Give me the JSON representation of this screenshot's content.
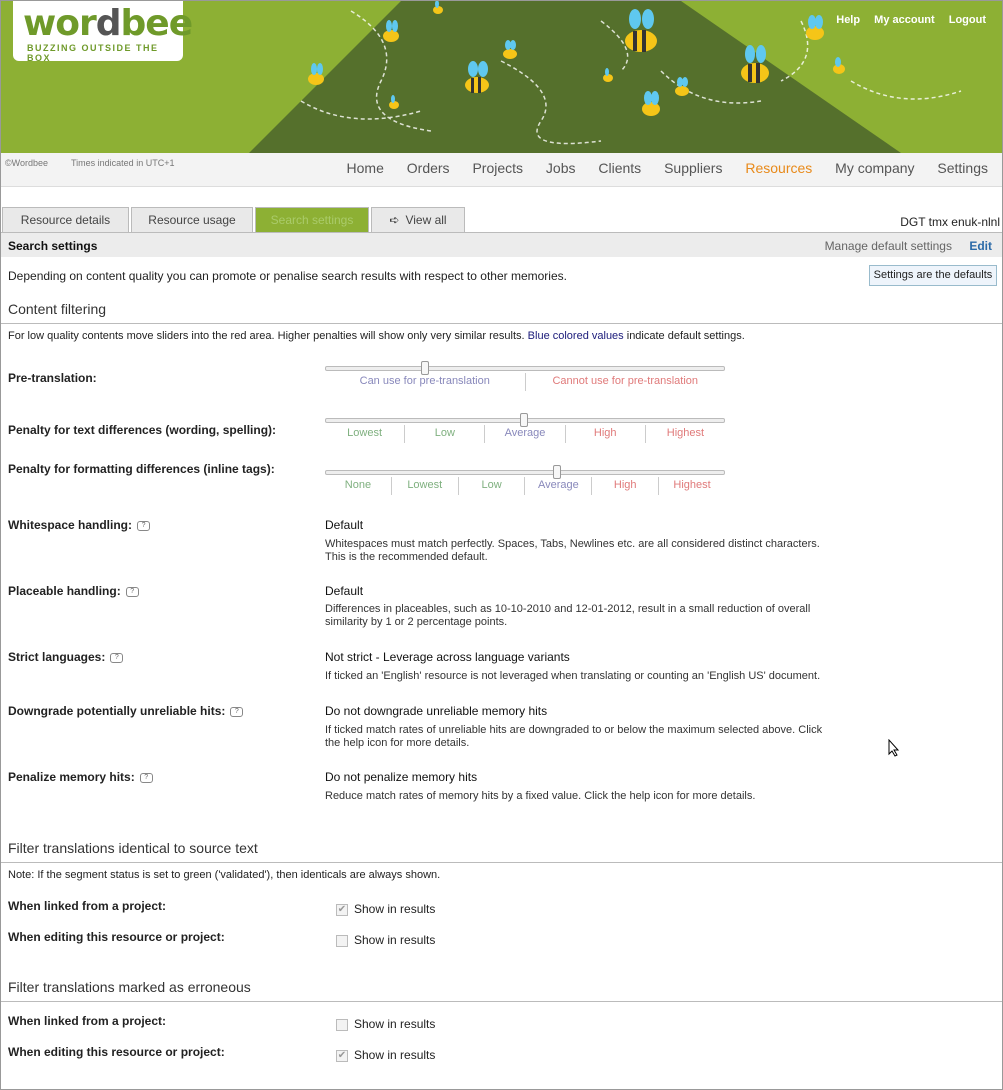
{
  "header": {
    "logo_main": "wordbee",
    "logo_tagline": "BUZZING OUTSIDE THE BOX",
    "links": [
      "Help",
      "My account",
      "Logout"
    ]
  },
  "subheader": {
    "copyright": "©Wordbee",
    "timezone": "Times indicated in UTC+1"
  },
  "nav": {
    "items": [
      "Home",
      "Orders",
      "Projects",
      "Jobs",
      "Clients",
      "Suppliers",
      "Resources",
      "My company",
      "Settings"
    ],
    "active": "Resources"
  },
  "tabs": [
    "Resource details",
    "Resource usage",
    "Search settings",
    "View all"
  ],
  "resource_name": "DGT tmx enuk-nlnl",
  "section": {
    "title": "Search settings",
    "manage_link": "Manage default settings",
    "edit_link": "Edit"
  },
  "intro": "Depending on content quality you can promote or penalise search results with respect to other memories.",
  "defaults_button": "Settings are the defaults",
  "content_filtering": {
    "heading": "Content filtering",
    "note_prefix": "For low quality contents move sliders into the red area. Higher penalties will show only very similar results.",
    "note_blue": "Blue colored values",
    "note_suffix": "indicate default settings.",
    "pretranslation": {
      "label": "Pre-translation:",
      "options": [
        "Can use for pre-translation",
        "Cannot use for pre-translation"
      ],
      "selected_index": 0
    },
    "text_diff": {
      "label": "Penalty for text differences (wording, spelling):",
      "options": [
        "Lowest",
        "Low",
        "Average",
        "High",
        "Highest"
      ],
      "selected_index": 2
    },
    "format_diff": {
      "label": "Penalty for formatting differences (inline tags):",
      "options": [
        "None",
        "Lowest",
        "Low",
        "Average",
        "High",
        "Highest"
      ],
      "selected_index": 3
    },
    "whitespace": {
      "label": "Whitespace handling:",
      "value": "Default",
      "desc": "Whitespaces must match perfectly. Spaces, Tabs, Newlines etc. are all considered distinct characters. This is the recommended default."
    },
    "placeable": {
      "label": "Placeable handling:",
      "value": "Default",
      "desc": "Differences in placeables, such as 10-10-2010 and 12-01-2012, result in a small reduction of overall similarity by 1 or 2 percentage points."
    },
    "strict_languages": {
      "label": "Strict languages:",
      "value": "Not strict - Leverage across language variants",
      "desc": "If ticked an 'English' resource is not leveraged when translating or counting an 'English US' document."
    },
    "downgrade": {
      "label": "Downgrade potentially unreliable hits:",
      "value": "Do not downgrade unreliable memory hits",
      "desc": "If ticked match rates of unreliable hits are downgraded to or below the maximum selected above. Click the help icon for more details."
    },
    "penalize": {
      "label": "Penalize memory hits:",
      "value": "Do not penalize memory hits",
      "desc": "Reduce match rates of memory hits by a fixed value. Click the help icon for more details."
    }
  },
  "identical": {
    "heading": "Filter translations identical to source text",
    "note": "Note: If the segment status is set to green ('validated'), then identicals are always shown.",
    "rows": [
      {
        "label": "When linked from a project:",
        "option": "Show in results",
        "checked": true
      },
      {
        "label": "When editing this resource or project:",
        "option": "Show in results",
        "checked": false
      }
    ]
  },
  "erroneous": {
    "heading": "Filter translations marked as erroneous",
    "rows": [
      {
        "label": "When linked from a project:",
        "option": "Show in results",
        "checked": false
      },
      {
        "label": "When editing this resource or project:",
        "option": "Show in results",
        "checked": true
      }
    ]
  },
  "colors": {
    "brand_green": "#8db034",
    "accent_orange": "#e88a1a",
    "link_blue": "#2b6aa8"
  }
}
